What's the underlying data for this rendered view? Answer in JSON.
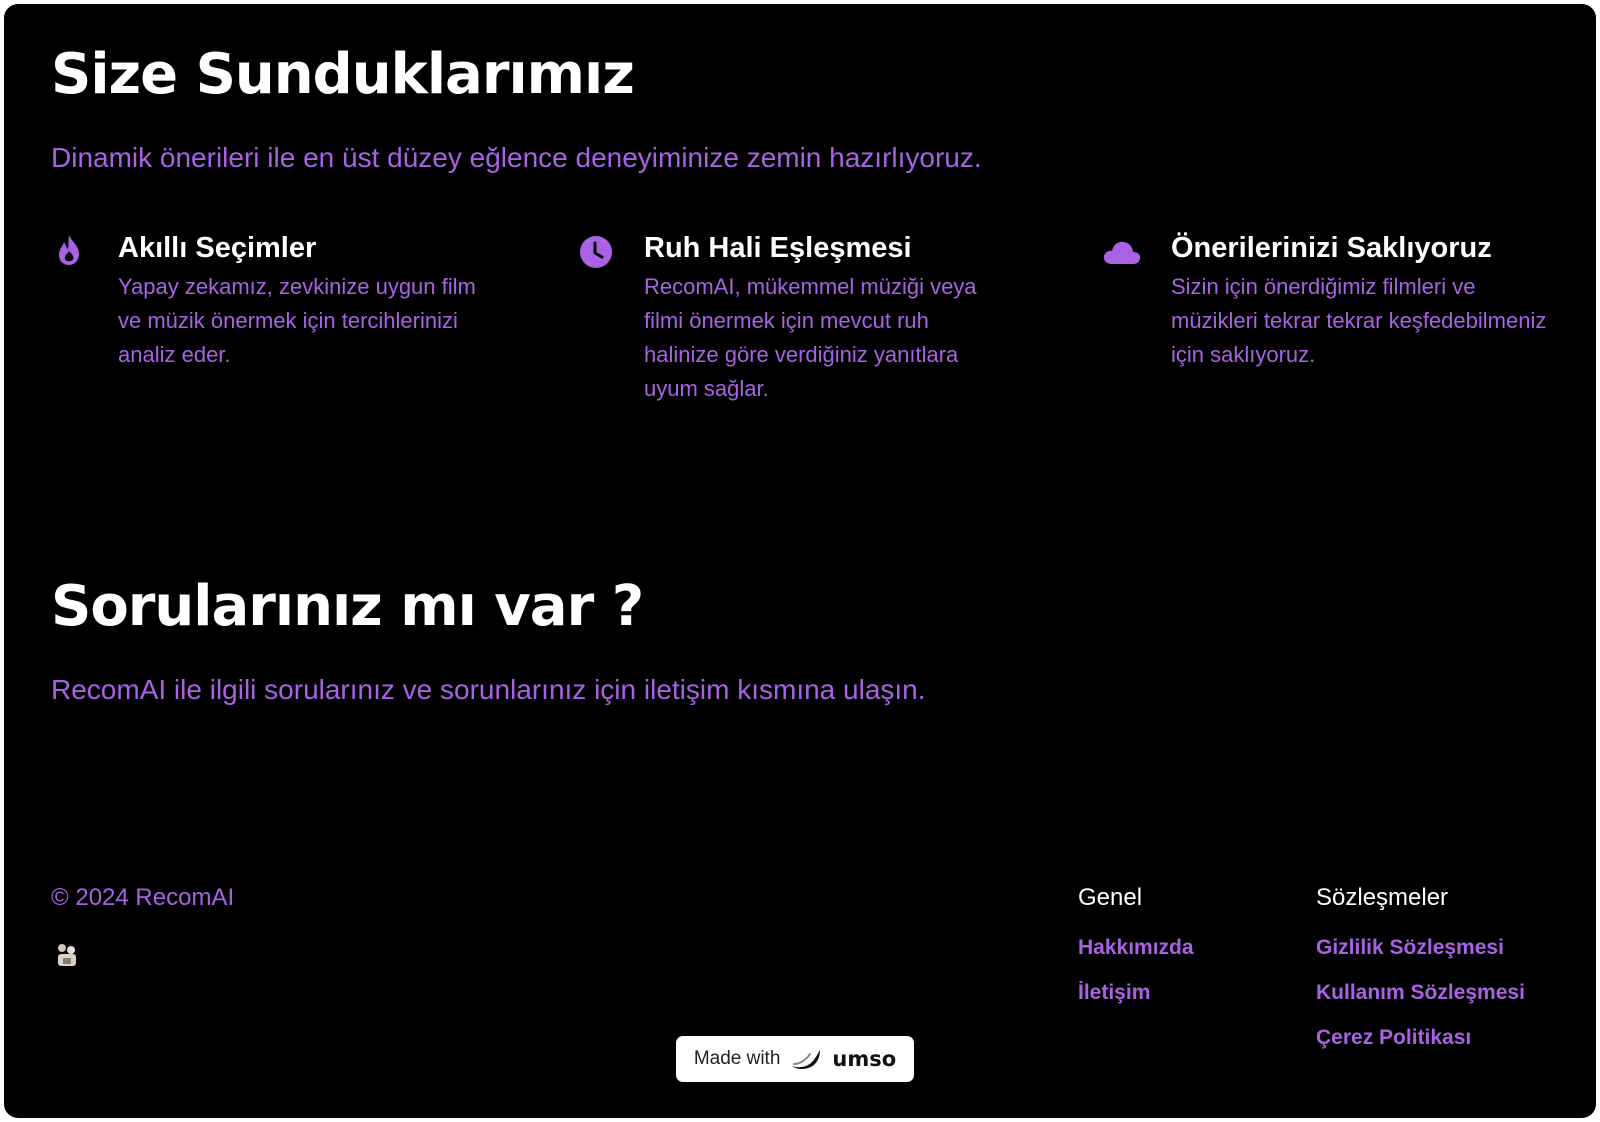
{
  "theme": {
    "background": "#000000",
    "accent": "#a862e3",
    "heading": "#ffffff"
  },
  "features_section": {
    "title": "Size Sunduklarımız",
    "subtitle": "Dinamik önerileri ile en üst düzey eğlence deneyiminize zemin hazırlıyoruz.",
    "items": [
      {
        "icon": "fire-icon",
        "title": "Akıllı Seçimler",
        "description": "Yapay zekamız, zevkinize uygun film ve müzik önermek için tercihlerinizi analiz eder."
      },
      {
        "icon": "clock-icon",
        "title": "Ruh Hali Eşleşmesi",
        "description": "RecomAI, mükemmel müziği veya filmi önermek için mevcut ruh halinize göre verdiğiniz yanıtlara uyum sağlar."
      },
      {
        "icon": "cloud-icon",
        "title": "Önerilerinizi Saklıyoruz",
        "description": "Sizin için önerdiğimiz filmleri ve müzikleri tekrar tekrar keşfedebilmeniz için saklıyoruz."
      }
    ]
  },
  "questions_section": {
    "title": "Sorularınız mı var ?",
    "subtitle": "RecomAI ile ilgili sorularınız ve sorunlarınız için iletişim kısmına ulaşın."
  },
  "footer": {
    "copyright": "© 2024 RecomAI",
    "logo_icon": "brand-logo-icon",
    "columns": [
      {
        "title": "Genel",
        "links": [
          "Hakkımızda",
          "İletişim"
        ]
      },
      {
        "title": "Sözleşmeler",
        "links": [
          "Gizlilik Sözleşmesi",
          "Kullanım Sözleşmesi",
          "Çerez Politikası"
        ]
      }
    ]
  },
  "badge": {
    "prefix": "Made with",
    "brand": "umso",
    "icon": "umso-logo-icon"
  }
}
